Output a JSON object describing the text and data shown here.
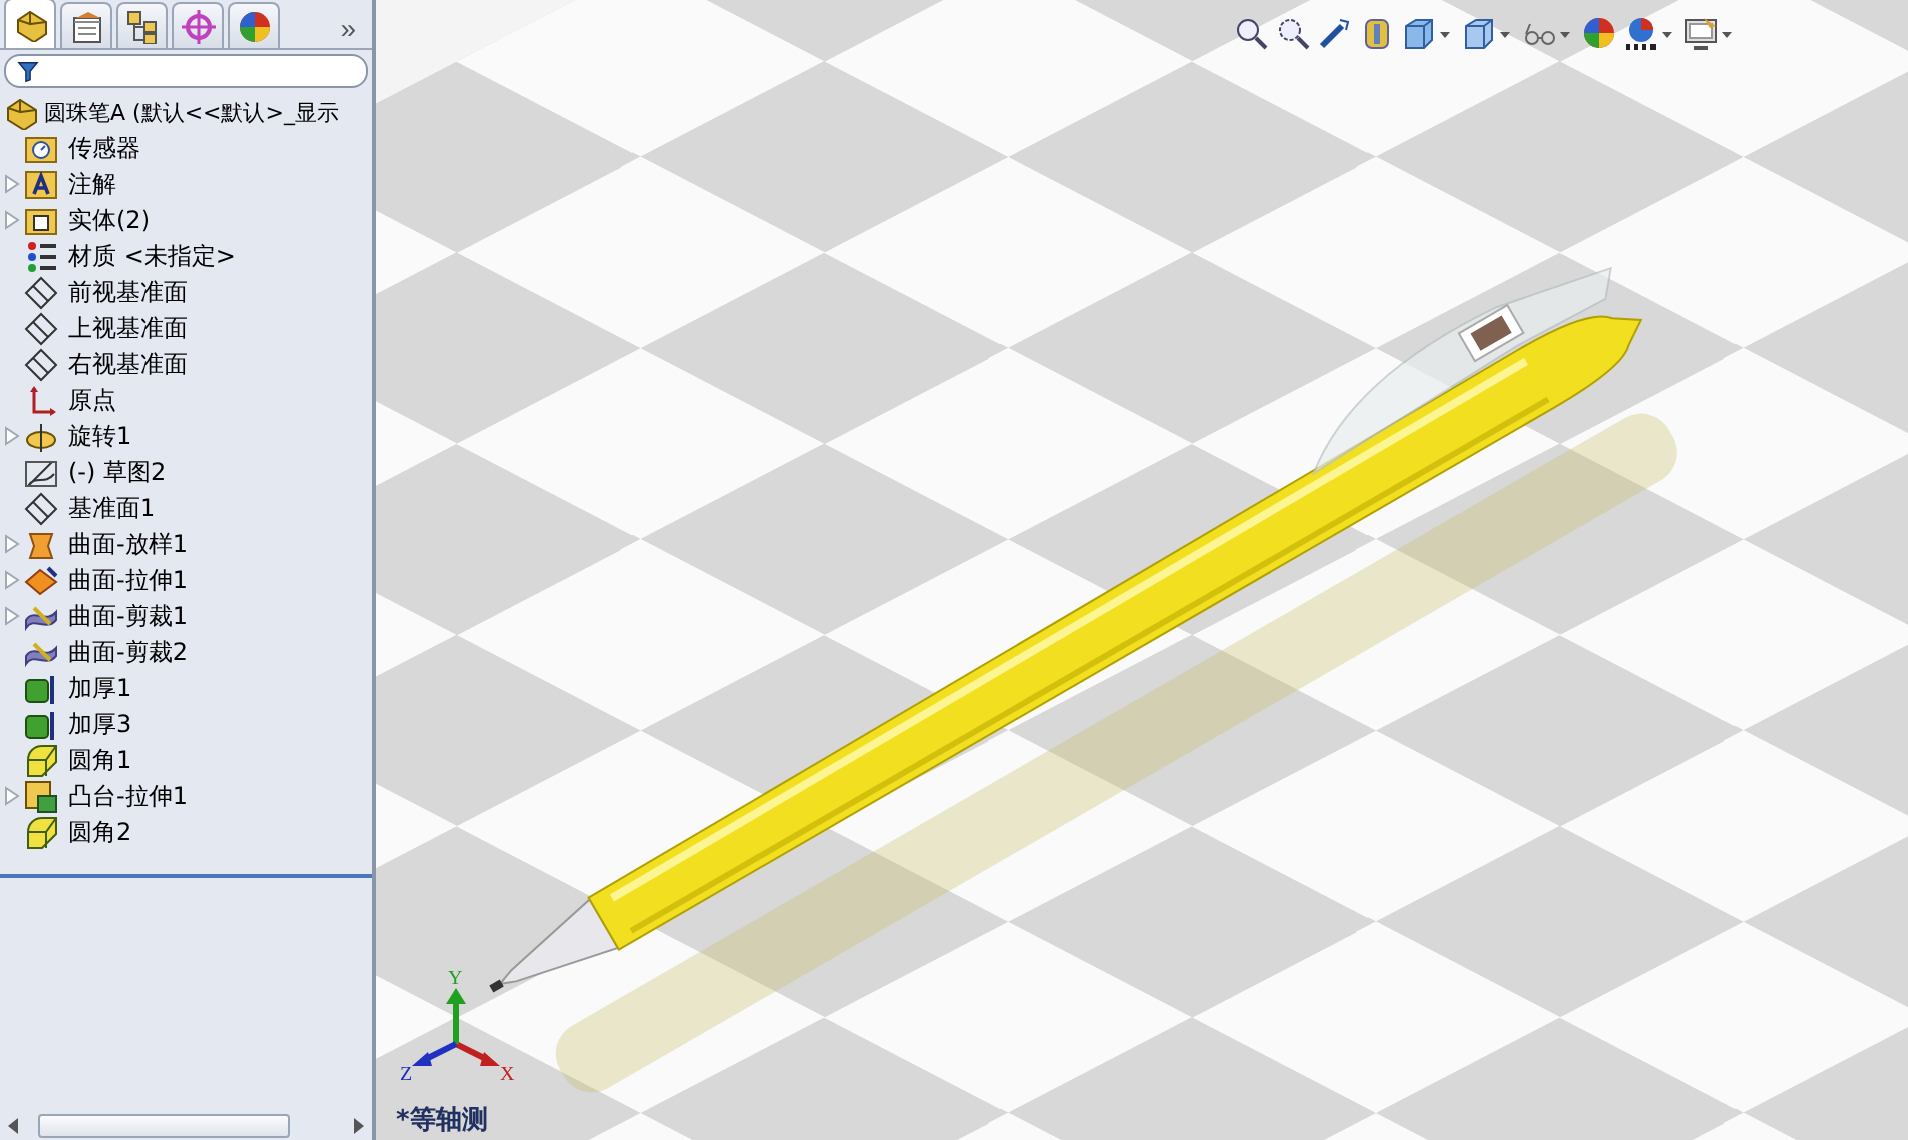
{
  "feature_panel": {
    "tabs": [
      {
        "selected": true
      },
      {
        "selected": false
      },
      {
        "selected": false
      },
      {
        "selected": false
      },
      {
        "selected": false
      }
    ],
    "more_button": "»",
    "tree": {
      "label": "圆珠笔A (默认<<默认>_显示",
      "kind": "part",
      "children": [
        {
          "label": "传感器",
          "kind": "sensor",
          "expandable": false
        },
        {
          "label": "注解",
          "kind": "annotation",
          "expandable": true
        },
        {
          "label": "实体(2)",
          "kind": "solid",
          "expandable": true
        },
        {
          "label": "材质 <未指定>",
          "kind": "material",
          "expandable": false
        },
        {
          "label": "前视基准面",
          "kind": "plane",
          "expandable": false
        },
        {
          "label": "上视基准面",
          "kind": "plane",
          "expandable": false
        },
        {
          "label": "右视基准面",
          "kind": "plane",
          "expandable": false
        },
        {
          "label": "原点",
          "kind": "origin",
          "expandable": false
        },
        {
          "label": "旋转1",
          "kind": "revolve",
          "expandable": true
        },
        {
          "label": "(-) 草图2",
          "kind": "sketch",
          "expandable": false
        },
        {
          "label": "基准面1",
          "kind": "plane",
          "expandable": false
        },
        {
          "label": "曲面-放样1",
          "kind": "loft",
          "expandable": true
        },
        {
          "label": "曲面-拉伸1",
          "kind": "surface-extrude",
          "expandable": true
        },
        {
          "label": "曲面-剪裁1",
          "kind": "trim",
          "expandable": true
        },
        {
          "label": "曲面-剪裁2",
          "kind": "trim",
          "expandable": false
        },
        {
          "label": "加厚1",
          "kind": "thicken",
          "expandable": false
        },
        {
          "label": "加厚3",
          "kind": "thicken",
          "expandable": false
        },
        {
          "label": "圆角1",
          "kind": "fillet",
          "expandable": false
        },
        {
          "label": "凸台-拉伸1",
          "kind": "boss",
          "expandable": true
        },
        {
          "label": "圆角2",
          "kind": "fillet",
          "expandable": false
        }
      ]
    }
  },
  "viewport": {
    "triad": {
      "x": "X",
      "y": "Y",
      "z": "Z"
    },
    "view_name": "*等轴测"
  }
}
